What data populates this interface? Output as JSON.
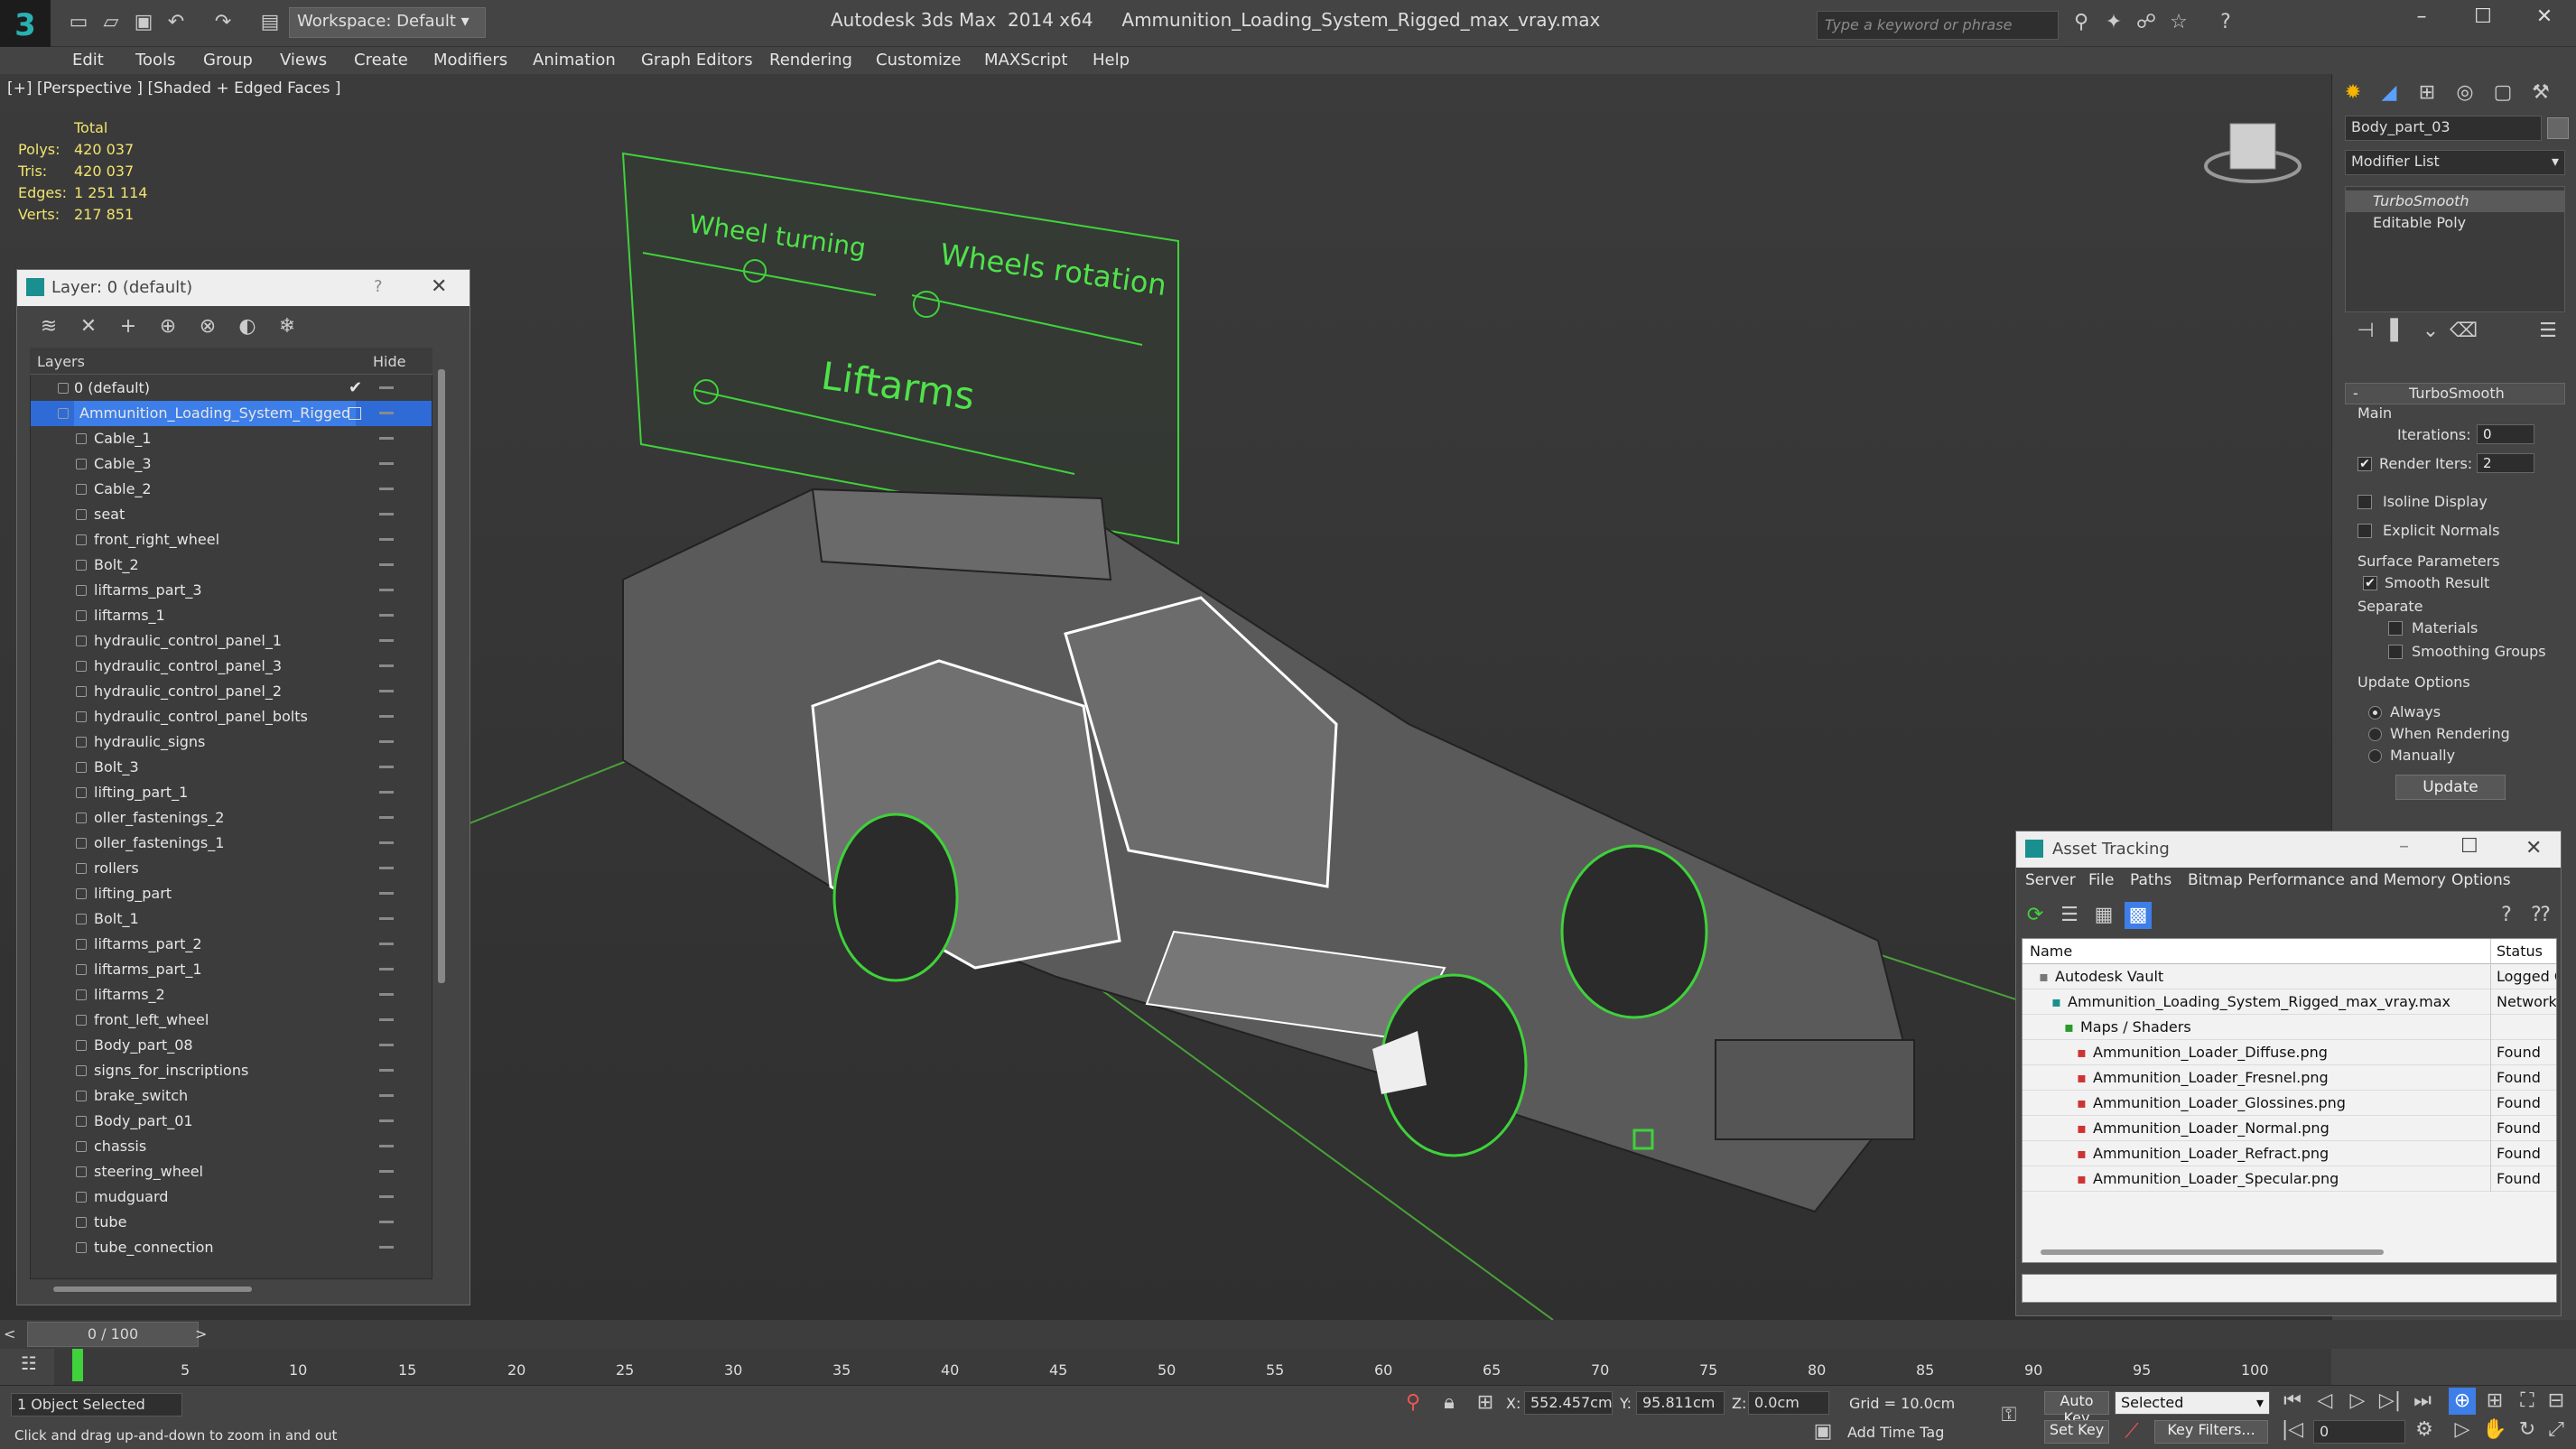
{
  "app": {
    "title": "Autodesk 3ds Max  2014 x64     Ammunition_Loading_System_Rigged_max_vray.max",
    "workspace": "Workspace: Default",
    "search_placeholder": "Type a keyword or phrase"
  },
  "menu": [
    "Edit",
    "Tools",
    "Group",
    "Views",
    "Create",
    "Modifiers",
    "Animation",
    "Graph Editors",
    "Rendering",
    "Customize",
    "MAXScript",
    "Help"
  ],
  "viewport": {
    "label": "[+] [Perspective ] [Shaded + Edged Faces ]",
    "stats_header": "Total",
    "stats": [
      {
        "label": "Polys:",
        "value": "420 037"
      },
      {
        "label": "Tris:",
        "value": "420 037"
      },
      {
        "label": "Edges:",
        "value": "1 251 114"
      },
      {
        "label": "Verts:",
        "value": "217 851"
      }
    ],
    "panel_labels": {
      "wheel_turning": "Wheel turning",
      "wheels_rotation": "Wheels rotation",
      "liftarms": "Liftarms"
    }
  },
  "layer_window": {
    "title": "Layer: 0 (default)",
    "help": "?",
    "col_layers": "Layers",
    "col_hide": "Hide",
    "rows": [
      "0 (default)",
      "Ammunition_Loading_System_Rigged",
      "Cable_1",
      "Cable_3",
      "Cable_2",
      "seat",
      "front_right_wheel",
      "Bolt_2",
      "liftarms_part_3",
      "liftarms_1",
      "hydraulic_control_panel_1",
      "hydraulic_control_panel_3",
      "hydraulic_control_panel_2",
      "hydraulic_control_panel_bolts",
      "hydraulic_signs",
      "Bolt_3",
      "lifting_part_1",
      "oller_fastenings_2",
      "oller_fastenings_1",
      "rollers",
      "lifting_part",
      "Bolt_1",
      "liftarms_part_2",
      "liftarms_part_1",
      "liftarms_2",
      "front_left_wheel",
      "Body_part_08",
      "signs_for_inscriptions",
      "brake_switch",
      "Body_part_01",
      "chassis",
      "steering_wheel",
      "mudguard",
      "tube",
      "tube_connection"
    ]
  },
  "command_panel": {
    "object_name": "Body_part_03",
    "modifier_list": "Modifier List",
    "stack": [
      "TurboSmooth",
      "Editable Poly"
    ],
    "rollout_title": "TurboSmooth",
    "main_label": "Main",
    "iterations_label": "Iterations:",
    "iterations_value": "0",
    "render_iters_label": "Render Iters:",
    "render_iters_value": "2",
    "isoline": "Isoline Display",
    "explicit_normals": "Explicit Normals",
    "surface_params": "Surface Parameters",
    "smooth_result": "Smooth Result",
    "separate": "Separate",
    "materials": "Materials",
    "smoothing_groups": "Smoothing Groups",
    "update_options": "Update Options",
    "always": "Always",
    "when_rendering": "When Rendering",
    "manually": "Manually",
    "update_btn": "Update"
  },
  "asset_tracking": {
    "title": "Asset Tracking",
    "menu": [
      "Server",
      "File",
      "Paths",
      "Bitmap Performance and Memory",
      "Options"
    ],
    "col_name": "Name",
    "col_status": "Status",
    "rows": [
      {
        "name": "Autodesk Vault",
        "status": "Logged C"
      },
      {
        "name": "Ammunition_Loading_System_Rigged_max_vray.max",
        "status": "Network"
      },
      {
        "name": "Maps / Shaders",
        "status": ""
      },
      {
        "name": "Ammunition_Loader_Diffuse.png",
        "status": "Found"
      },
      {
        "name": "Ammunition_Loader_Fresnel.png",
        "status": "Found"
      },
      {
        "name": "Ammunition_Loader_Glossines.png",
        "status": "Found"
      },
      {
        "name": "Ammunition_Loader_Normal.png",
        "status": "Found"
      },
      {
        "name": "Ammunition_Loader_Refract.png",
        "status": "Found"
      },
      {
        "name": "Ammunition_Loader_Specular.png",
        "status": "Found"
      }
    ]
  },
  "timeline": {
    "frame": "0 / 100",
    "ticks": [
      "5",
      "10",
      "15",
      "20",
      "25",
      "30",
      "35",
      "40",
      "45",
      "50",
      "55",
      "60",
      "65",
      "70",
      "75",
      "80",
      "85",
      "90",
      "95",
      "100"
    ]
  },
  "status": {
    "selected": "1 Object Selected",
    "hint": "Click and drag up-and-down to zoom in and out",
    "x_label": "X:",
    "x_value": "552.457cm",
    "y_label": "Y:",
    "y_value": "95.811cm",
    "z_label": "Z:",
    "z_value": "0.0cm",
    "grid": "Grid = 10.0cm",
    "auto_key": "Auto Key",
    "set_key": "Set Key",
    "selected_dropdown": "Selected",
    "key_filters": "Key Filters...",
    "add_time_tag": "Add Time Tag",
    "frame_field": "0"
  }
}
